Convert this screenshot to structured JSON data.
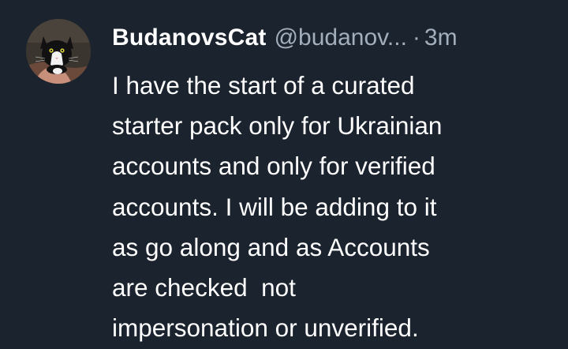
{
  "post": {
    "author": {
      "display_name": "BudanovsCat",
      "handle": "@budanov...",
      "avatar_icon": "cat-avatar"
    },
    "separator": "·",
    "timestamp": "3m",
    "text_lines": [
      "I have the start of a curated",
      "starter pack only for Ukrainian",
      "accounts and only for verified",
      "accounts. I will be adding to it",
      "as go along and as Accounts",
      "are checked  not",
      "impersonation or unverified."
    ]
  },
  "colors": {
    "background": "#1b232e",
    "text_primary": "#ffffff",
    "text_secondary": "#a3aebc"
  }
}
